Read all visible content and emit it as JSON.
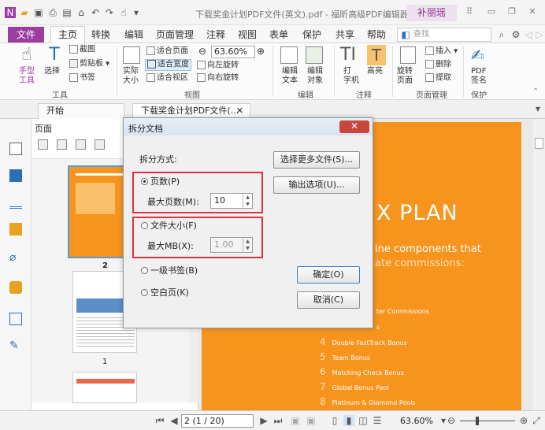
{
  "titlebar": {
    "doc_title": "下载奖金计划PDF文件(英文).pdf - 福昕高级PDF编辑器",
    "user": "补丽瑶"
  },
  "menu": {
    "file": "文件",
    "items": [
      "主页",
      "转换",
      "编辑",
      "页面管理",
      "注释",
      "视图",
      "表单",
      "保护",
      "共享",
      "帮助"
    ],
    "search_placeholder": "查找"
  },
  "ribbon": {
    "hand": "手型\n工具",
    "select": "选择",
    "screenshot": "截图",
    "clipboard": "剪贴板",
    "bookmark": "书签",
    "tools_group": "工具",
    "actual_size": "实际\n大小",
    "fit_page": "适合页面",
    "fit_width": "适合宽度",
    "fit_view": "适合视区",
    "zoom": "63.60%",
    "rotate_left": "向左旋转",
    "rotate_right": "向右旋转",
    "view_group": "视图",
    "edit_text": "编辑\n文本",
    "edit_object": "编辑\n对象",
    "edit_group": "编辑",
    "typewriter": "打\n字机",
    "highlight": "高亮",
    "comment_group": "注释",
    "rotate_page": "旋转\n页面",
    "insert": "插入",
    "delete": "删除",
    "extract": "提取",
    "page_group": "页面管理",
    "pdf_sign": "PDF\n签名",
    "protect_group": "保护"
  },
  "tabs": [
    "开始",
    "下载奖金计划PDF文件(..."
  ],
  "panel": {
    "title": "页面",
    "thumb_labels": [
      "2",
      "1"
    ]
  },
  "pdf": {
    "heading": "X PLAN",
    "lines": [
      "ine components that",
      "ate commissions:"
    ],
    "list": [
      {
        "n": "",
        "t": "ter Commissions"
      },
      {
        "n": "",
        "t": "s"
      },
      {
        "n": "4",
        "t": "Double FastTrack Bonus"
      },
      {
        "n": "5",
        "t": "Team Bonus"
      },
      {
        "n": "6",
        "t": "Matching Check Bonus"
      },
      {
        "n": "7",
        "t": "Global Bonus Pool"
      },
      {
        "n": "8",
        "t": "Platinum & Diamond Pools"
      }
    ]
  },
  "status": {
    "page": "2 (1 / 20)",
    "zoom": "63.60%"
  },
  "dialog": {
    "title": "拆分文档",
    "split_mode": "拆分方式:",
    "more_files": "选择更多文件(S)...",
    "output_options": "输出选项(U)...",
    "opt_pages": "页数(P)",
    "max_pages_label": "最大页数(M):",
    "max_pages": "10",
    "opt_size": "文件大小(F)",
    "max_mb_label": "最大MB(X):",
    "max_mb": "1.00",
    "opt_bookmark": "一级书签(B)",
    "opt_blank": "空白页(K)",
    "ok": "确定(O)",
    "cancel": "取消(C)"
  },
  "colors": {
    "accent": "#9b3ea0",
    "pdf_orange": "#f7941d",
    "highlight_red": "#e0313a"
  }
}
